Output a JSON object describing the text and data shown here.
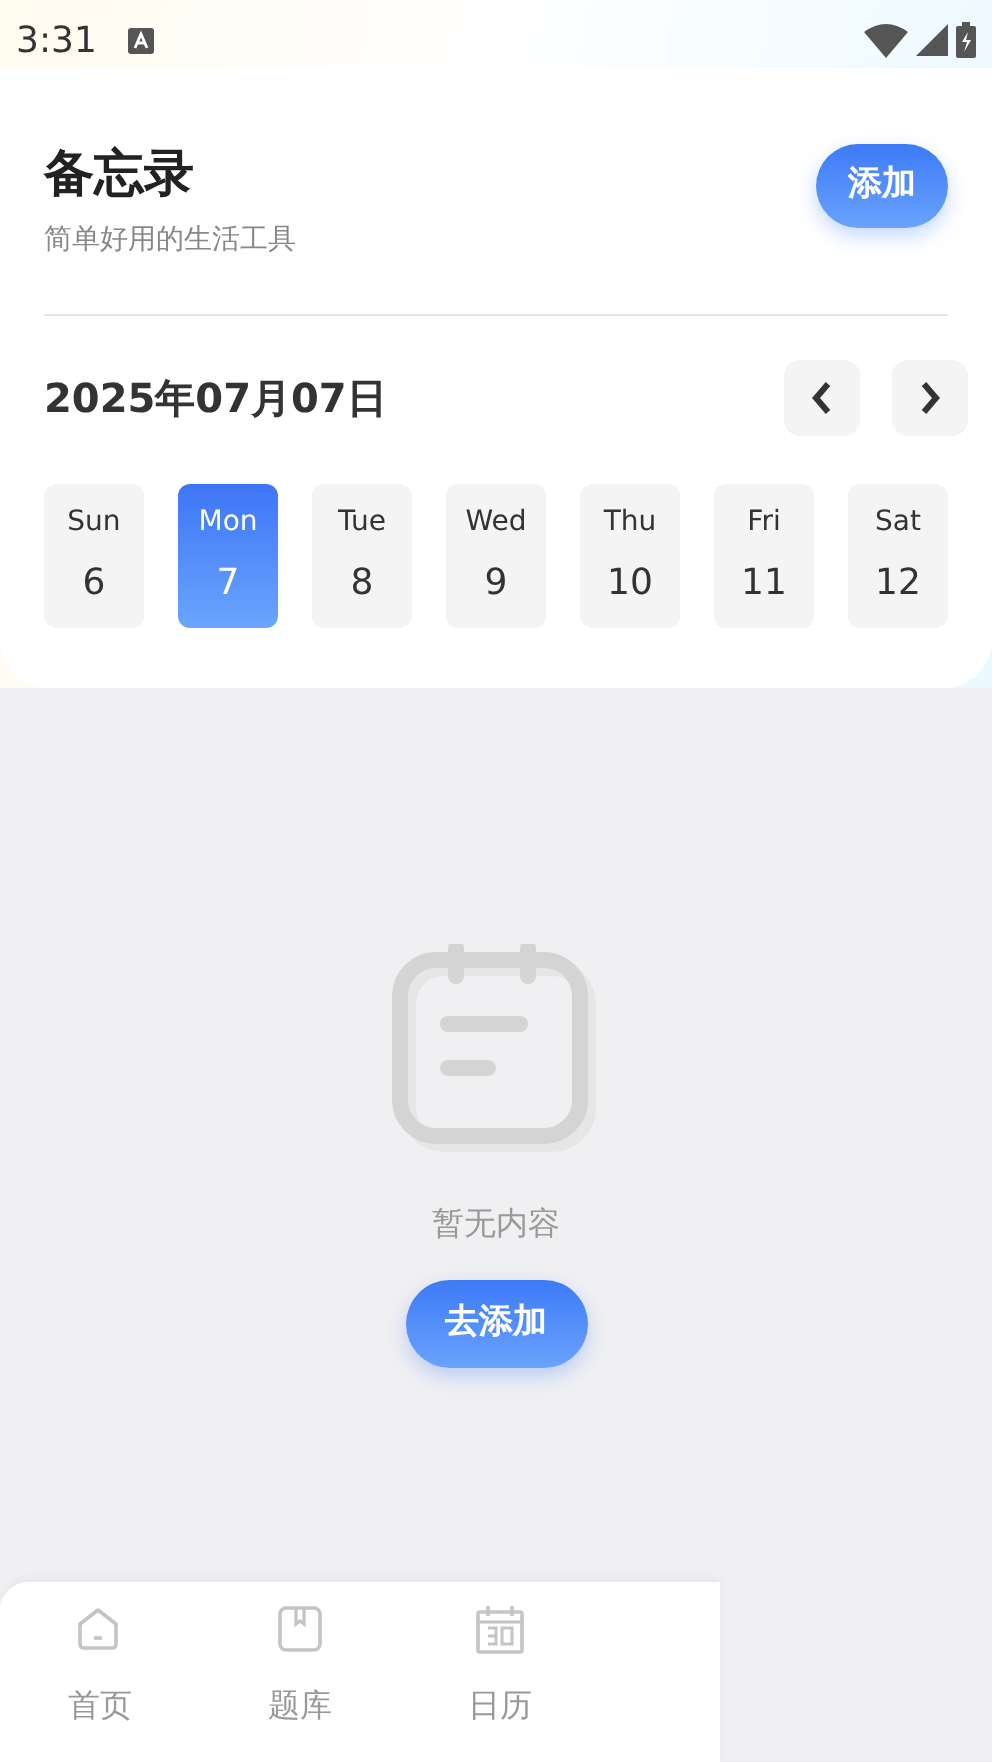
{
  "status_bar": {
    "time": "3:31"
  },
  "header": {
    "title": "备忘录",
    "subtitle": "简单好用的生活工具",
    "add_button": "添加"
  },
  "date_nav": {
    "date": "2025年07月07日"
  },
  "days": [
    {
      "weekday": "Sun",
      "day": "6",
      "selected": false
    },
    {
      "weekday": "Mon",
      "day": "7",
      "selected": true
    },
    {
      "weekday": "Tue",
      "day": "8",
      "selected": false
    },
    {
      "weekday": "Wed",
      "day": "9",
      "selected": false
    },
    {
      "weekday": "Thu",
      "day": "10",
      "selected": false
    },
    {
      "weekday": "Fri",
      "day": "11",
      "selected": false
    },
    {
      "weekday": "Sat",
      "day": "12",
      "selected": false
    }
  ],
  "empty_state": {
    "message": "暂无内容",
    "button": "去添加"
  },
  "bottom_nav": [
    {
      "label": "首页",
      "selected": false
    },
    {
      "label": "题库",
      "selected": false
    },
    {
      "label": "日历",
      "selected": false
    }
  ]
}
